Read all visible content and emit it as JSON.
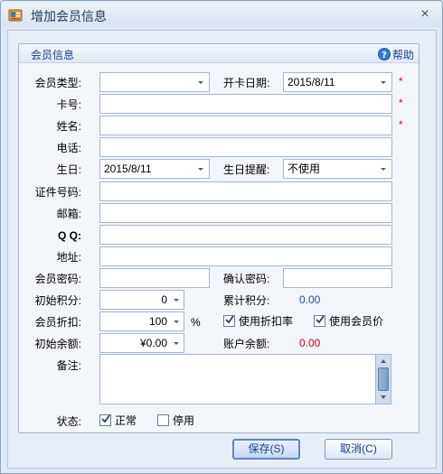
{
  "window": {
    "title": "增加会员信息",
    "close_glyph": "×"
  },
  "group": {
    "title": "会员信息",
    "help_label": "帮助"
  },
  "fields": {
    "member_type": {
      "label": "会员类型:",
      "value": ""
    },
    "open_date": {
      "label": "开卡日期:",
      "value": "2015/8/11"
    },
    "card_no": {
      "label": "卡号:",
      "value": ""
    },
    "name": {
      "label": "姓名:",
      "value": ""
    },
    "phone": {
      "label": "电话:",
      "value": ""
    },
    "birthday": {
      "label": "生日:",
      "value": "2015/8/11"
    },
    "birthday_reminder": {
      "label": "生日提醒:",
      "value": "不使用"
    },
    "id_no": {
      "label": "证件号码:",
      "value": ""
    },
    "email": {
      "label": "邮箱:",
      "value": ""
    },
    "qq": {
      "label": "Q Q:",
      "value": ""
    },
    "address": {
      "label": "地址:",
      "value": ""
    },
    "member_password": {
      "label": "会员密码:",
      "value": ""
    },
    "confirm_password": {
      "label": "确认密码:",
      "value": ""
    },
    "initial_points": {
      "label": "初始积分:",
      "value": "0"
    },
    "accumulated_points": {
      "label": "累计积分:",
      "value": "0.00"
    },
    "member_discount": {
      "label": "会员折扣:",
      "value": "100",
      "unit": "%"
    },
    "initial_balance": {
      "label": "初始余额:",
      "value": "¥0.00"
    },
    "account_balance": {
      "label": "账户余额:",
      "value": "0.00"
    },
    "remarks": {
      "label": "备注:",
      "value": ""
    },
    "status": {
      "label": "状态:"
    }
  },
  "required_mark": "*",
  "checkboxes": {
    "use_discount_rate": {
      "label": "使用折扣率",
      "checked": true
    },
    "use_member_price": {
      "label": "使用会员价",
      "checked": true
    },
    "status_normal": {
      "label": "正常",
      "checked": true
    },
    "status_disabled": {
      "label": "停用",
      "checked": false
    }
  },
  "buttons": {
    "save": "保存(S)",
    "cancel": "取消(C)"
  },
  "colors": {
    "accent": "#15428b",
    "value_blue": "#1c4b9c",
    "value_red": "#d1001a",
    "required": "#e0001b"
  },
  "icons": {
    "app": "app-member-icon",
    "help": "help-icon",
    "dropdown": "chevron-down-icon",
    "check": "check-icon"
  }
}
